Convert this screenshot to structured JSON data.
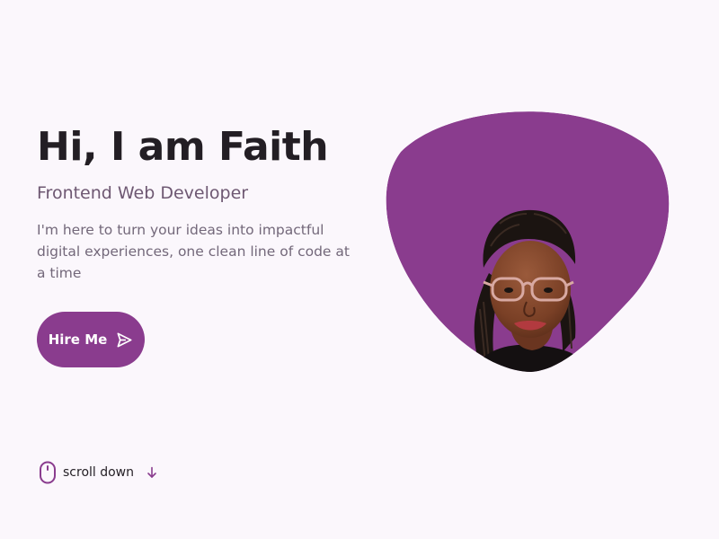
{
  "hero": {
    "title": "Hi, I am Faith",
    "subtitle": "Frontend Web Developer",
    "description": "I'm here to turn your ideas into impactful digital experiences, one clean line of code at a time"
  },
  "cta": {
    "label": "Hire Me",
    "icon": "send-icon"
  },
  "scroll": {
    "label": "scroll down",
    "icons": [
      "mouse-icon",
      "arrow-down-icon"
    ]
  },
  "profile": {
    "shape": "blob",
    "image": "profile-photo"
  },
  "colors": {
    "accent": "#8a3c8e",
    "background": "#fbf7fc",
    "text": "#231e24",
    "subtitle": "#6e5872",
    "muted": "#73687a"
  }
}
